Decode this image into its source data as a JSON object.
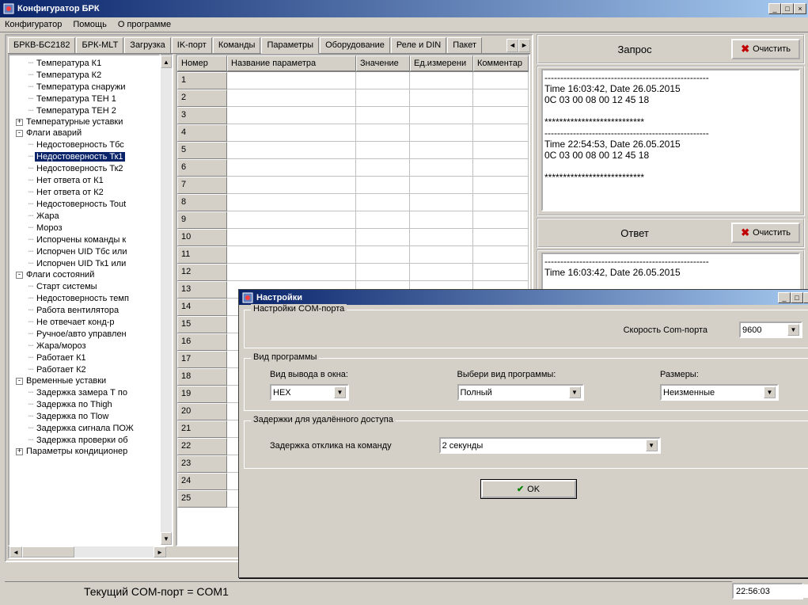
{
  "window": {
    "title": "Конфигуратор БРК",
    "minimize": "_",
    "maximize": "□",
    "close": "×"
  },
  "menu": [
    "Конфигуратор",
    "Помощь",
    "О программе"
  ],
  "tabs": [
    {
      "label": "БРКВ-БС2182"
    },
    {
      "label": "БРК-MLT"
    },
    {
      "label": "Загрузка"
    },
    {
      "label": "IK-порт"
    },
    {
      "label": "Команды"
    },
    {
      "label": "Параметры",
      "active": true
    },
    {
      "label": "Оборудование"
    },
    {
      "label": "Реле и DIN"
    },
    {
      "label": "Пакет"
    }
  ],
  "tree": [
    {
      "indent": 20,
      "label": "Температура К1"
    },
    {
      "indent": 20,
      "label": "Температура К2"
    },
    {
      "indent": 20,
      "label": "Температура снаружи"
    },
    {
      "indent": 20,
      "label": "Температура ТЕН 1"
    },
    {
      "indent": 20,
      "label": "Температура ТЕН 2"
    },
    {
      "indent": 6,
      "label": "Температурные уставки",
      "toggle": "+"
    },
    {
      "indent": 6,
      "label": "Флаги аварий",
      "toggle": "-"
    },
    {
      "indent": 20,
      "label": "Недостоверность Тбс"
    },
    {
      "indent": 20,
      "label": "Недостоверность Тк1",
      "selected": true
    },
    {
      "indent": 20,
      "label": "Недостоверность Тк2"
    },
    {
      "indent": 20,
      "label": "Нет ответа от К1"
    },
    {
      "indent": 20,
      "label": "Нет ответа от К2"
    },
    {
      "indent": 20,
      "label": "Недостоверность Tout"
    },
    {
      "indent": 20,
      "label": "Жара"
    },
    {
      "indent": 20,
      "label": "Мороз"
    },
    {
      "indent": 20,
      "label": "Испорчены команды к"
    },
    {
      "indent": 20,
      "label": "Испорчен UID Тбс или"
    },
    {
      "indent": 20,
      "label": "Испорчен UID Тк1 или"
    },
    {
      "indent": 6,
      "label": "Флаги состояний",
      "toggle": "-"
    },
    {
      "indent": 20,
      "label": "Старт системы"
    },
    {
      "indent": 20,
      "label": "Недостоверность темп"
    },
    {
      "indent": 20,
      "label": "Работа вентилятора"
    },
    {
      "indent": 20,
      "label": "Не отвечает конд-р"
    },
    {
      "indent": 20,
      "label": "Ручное/авто управлен"
    },
    {
      "indent": 20,
      "label": "Жара/мороз"
    },
    {
      "indent": 20,
      "label": "Работает К1"
    },
    {
      "indent": 20,
      "label": "Работает К2"
    },
    {
      "indent": 6,
      "label": "Временные уставки",
      "toggle": "-"
    },
    {
      "indent": 20,
      "label": "Задержка замера Т по"
    },
    {
      "indent": 20,
      "label": "Задержка по Thigh"
    },
    {
      "indent": 20,
      "label": "Задержка по Tlow"
    },
    {
      "indent": 20,
      "label": "Задержка сигнала ПОЖ"
    },
    {
      "indent": 20,
      "label": "Задержка проверки об"
    },
    {
      "indent": 6,
      "label": "Параметры кондиционер",
      "toggle": "+"
    }
  ],
  "grid": {
    "headers": [
      "Номер",
      "Название параметра",
      "Значение",
      "Ед.измерени",
      "Комментар"
    ],
    "rowcount": 25
  },
  "rightpanel": {
    "request_label": "Запрос",
    "clear_label": "Очистить",
    "response_label": "Ответ",
    "log1": "----------------------------------------------------\nTime 16:03:42, Date 26.05.2015\n0C 03 00 08 00 12 45 18\n\n***************************\n----------------------------------------------------\nTime 22:54:53, Date 26.05.2015\n0C 03 00 08 00 12 45 18\n\n***************************",
    "log2": "----------------------------------------------------\nTime 16:03:42, Date 26.05.2015"
  },
  "status": {
    "port": "Текущий COM-порт = COM1",
    "time": "22:56:03"
  },
  "dialog": {
    "title": "Настройки",
    "grp1": "Настройки COM-порта",
    "speed_label": "Скорость Com-порта",
    "speed_value": "9600",
    "grp2": "Вид программы",
    "out_label": "Вид вывода в окна:",
    "out_value": "HEX",
    "prog_label": "Выбери вид программы:",
    "prog_value": "Полный",
    "size_label": "Размеры:",
    "size_value": "Неизменные",
    "grp3": "Задержки для удалённого доступа",
    "delay_label": "Задержка отклика на команду",
    "delay_value": "2 секунды",
    "ok": "OK"
  }
}
